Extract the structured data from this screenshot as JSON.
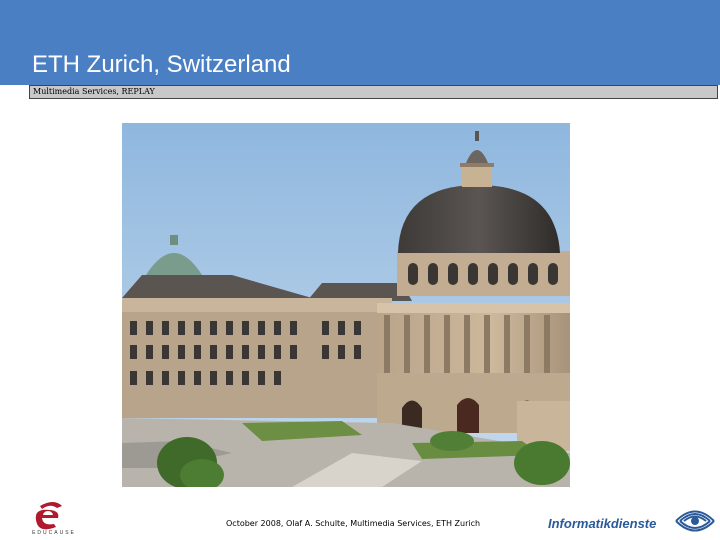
{
  "slide": {
    "title": "ETH Zurich, Switzerland",
    "subtitle": "Multimedia Services, REPLAY",
    "footer": "October 2008, Olaf A. Schulte, Multimedia Services, ETH Zurich",
    "photo_alt": "ETH Zurich main building",
    "logos": {
      "left": "EDUCAUSE",
      "right": "Informatikdienste"
    }
  },
  "colors": {
    "title_bar": "#4a7fc4",
    "subtitle_bar": "#c8c8c8",
    "sky": "#9fc3e4",
    "logo_blue": "#2b5a9a",
    "educause_red": "#b01a2c"
  }
}
